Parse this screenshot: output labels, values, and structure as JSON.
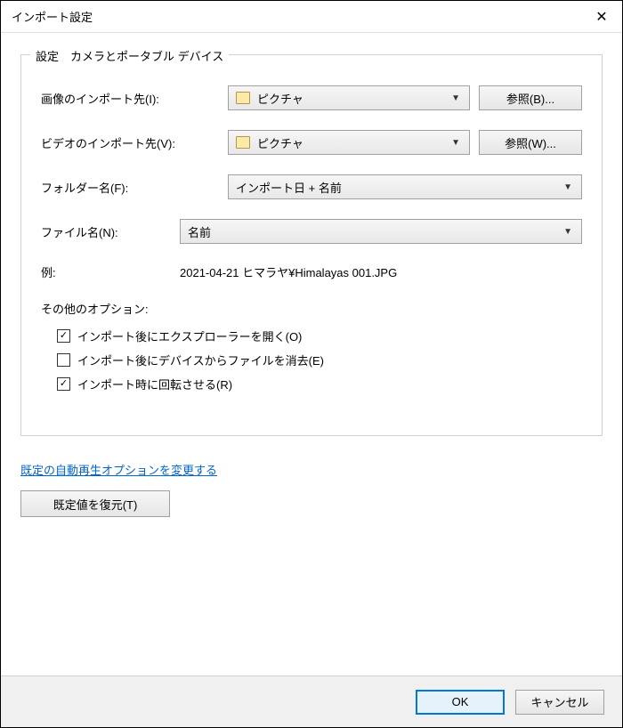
{
  "titlebar": {
    "title": "インポート設定"
  },
  "groupbox": {
    "label": "設定　カメラとポータブル デバイス",
    "image_dest_label": "画像のインポート先(I):",
    "image_dest_value": "ピクチャ",
    "image_browse": "参照(B)...",
    "video_dest_label": "ビデオのインポート先(V):",
    "video_dest_value": "ピクチャ",
    "video_browse": "参照(W)...",
    "folder_name_label": "フォルダー名(F):",
    "folder_name_value": "インポート日 + 名前",
    "file_name_label": "ファイル名(N):",
    "file_name_value": "名前",
    "example_label": "例:",
    "example_value": "2021-04-21 ヒマラヤ¥Himalayas 001.JPG",
    "other_options_label": "その他のオプション:",
    "checkbox_open_explorer": "インポート後にエクスプローラーを開く(O)",
    "checkbox_delete": "インポート後にデバイスからファイルを消去(E)",
    "checkbox_rotate": "インポート時に回転させる(R)"
  },
  "link_autoplay": "既定の自動再生オプションを変更する",
  "restore_defaults": "既定値を復元(T)",
  "footer": {
    "ok": "OK",
    "cancel": "キャンセル"
  },
  "checks": {
    "open": "✓",
    "delete": "",
    "rotate": "✓"
  }
}
